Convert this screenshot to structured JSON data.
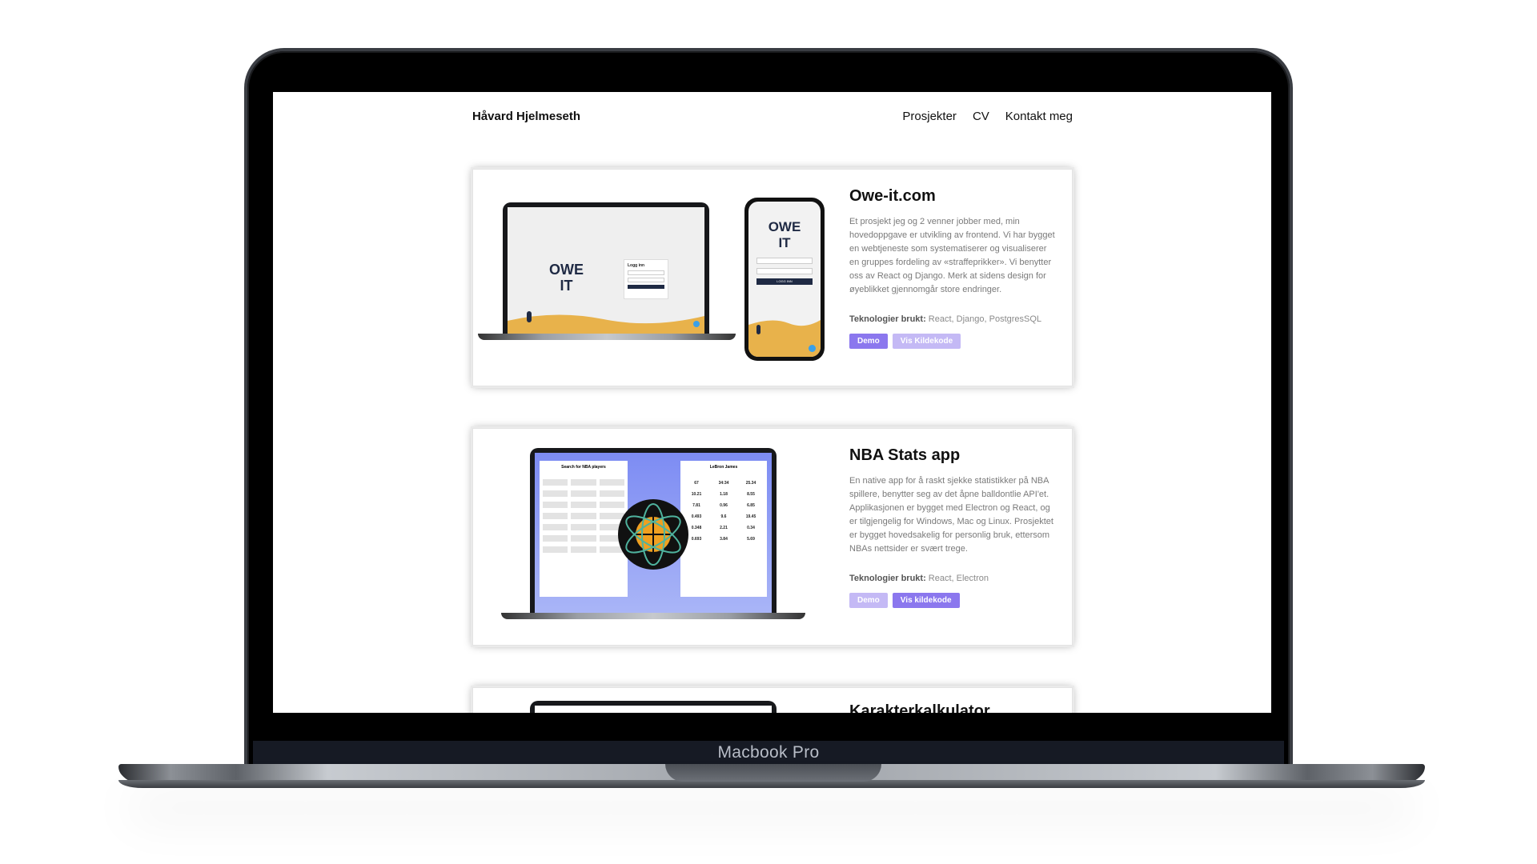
{
  "device": {
    "label": "Macbook Pro"
  },
  "site": {
    "brand": "Håvard Hjelmeseth",
    "menu": [
      "Prosjekter",
      "CV",
      "Kontakt meg"
    ]
  },
  "projects": [
    {
      "title": "Owe-it.com",
      "description": "Et prosjekt jeg og 2 venner jobber med, min hovedoppgave er utvikling av frontend. Vi har bygget en webtjeneste som systematiserer og visualiserer en gruppes fordeling av «straffeprikker». Vi benytter oss av React og Django. Merk at sidens design for øyeblikket gjennomgår store endringer.",
      "tech_label": "Teknologier brukt:",
      "tech": " React, Django, PostgresSQL",
      "demo_label": "Demo",
      "source_label": "Vis Kildekode",
      "mock_logo_line1": "OWE",
      "mock_logo_line2": "IT",
      "mock_login_title": "Logg inn",
      "mock_login_button": "LOGG INN"
    },
    {
      "title": "NBA Stats app",
      "description": "En native app for å raskt sjekke statistikker på NBA spillere, benytter seg av det åpne balldontlie API'et. Applikasjonen er bygget med Electron og React, og er tilgjengelig for Windows, Mac og Linux. Prosjektet er bygget hovedsakelig for personlig bruk, ettersom NBAs nettsider er svært trege.",
      "tech_label": "Teknologier brukt:",
      "tech": " React, Electron",
      "demo_label": "Demo",
      "source_label": "Vis kildekode",
      "mock_left_title": "Search for NBA players",
      "mock_right_title": "LeBron James",
      "mock_stats": [
        "67",
        "34:34",
        "25.34",
        "10.21",
        "1.18",
        "8.55",
        "7.81",
        "0.96",
        "6.85",
        "0.493",
        "9.6",
        "19.45",
        "0.348",
        "2.21",
        "0.34",
        "0.693",
        "3.84",
        "5.69"
      ]
    },
    {
      "title": "Karakterkalkulator"
    }
  ],
  "colors": {
    "accent": "#8b77ee",
    "accent_light": "#c4b9f5",
    "sand": "#e8b24b",
    "navy": "#1f2a44",
    "nba_bg": "#7d8cf3"
  }
}
